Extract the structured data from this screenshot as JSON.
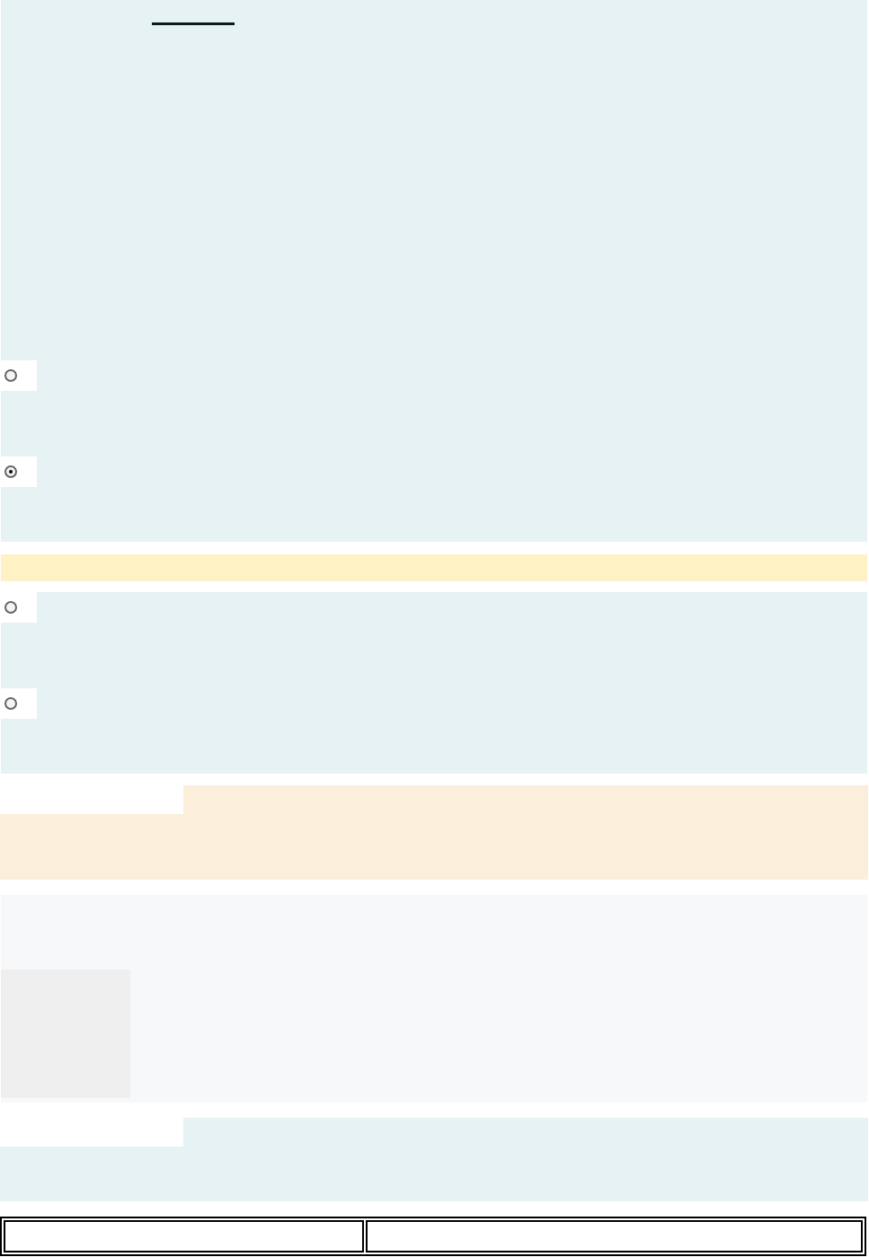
{
  "groups": [
    {
      "options": [
        {
          "selected": false
        },
        {
          "selected": true
        }
      ]
    },
    {
      "options": [
        {
          "selected": false
        },
        {
          "selected": false
        }
      ]
    }
  ]
}
